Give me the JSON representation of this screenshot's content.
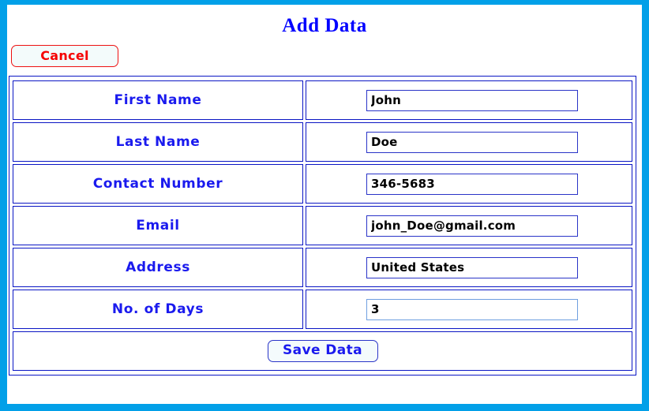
{
  "window": {
    "accent_border_color": "#02a0e8",
    "background_color": "#ffffff"
  },
  "header": {
    "title": "Add Data",
    "title_color": "#0000ff",
    "cancel_label": "Cancel",
    "cancel_text_color": "#f60000",
    "cancel_border_color": "#ee1111"
  },
  "form": {
    "border_color": "#0b16c4",
    "label_color": "#1a1aee",
    "input_border_color": "#2a34c8",
    "focused_input_border_color": "#6f9fe0",
    "rows": [
      {
        "label": "First Name",
        "value": "John",
        "focused": false
      },
      {
        "label": "Last Name",
        "value": "Doe",
        "focused": false
      },
      {
        "label": "Contact Number",
        "value": "346-5683",
        "focused": false
      },
      {
        "label": "Email",
        "value": "john_Doe@gmail.com",
        "focused": false
      },
      {
        "label": "Address",
        "value": "United States",
        "focused": false
      },
      {
        "label": "No. of Days",
        "value": "3",
        "focused": true
      }
    ]
  },
  "footer": {
    "save_label": "Save Data",
    "save_text_color": "#1a1aee",
    "save_border_color": "#2a34c8"
  }
}
